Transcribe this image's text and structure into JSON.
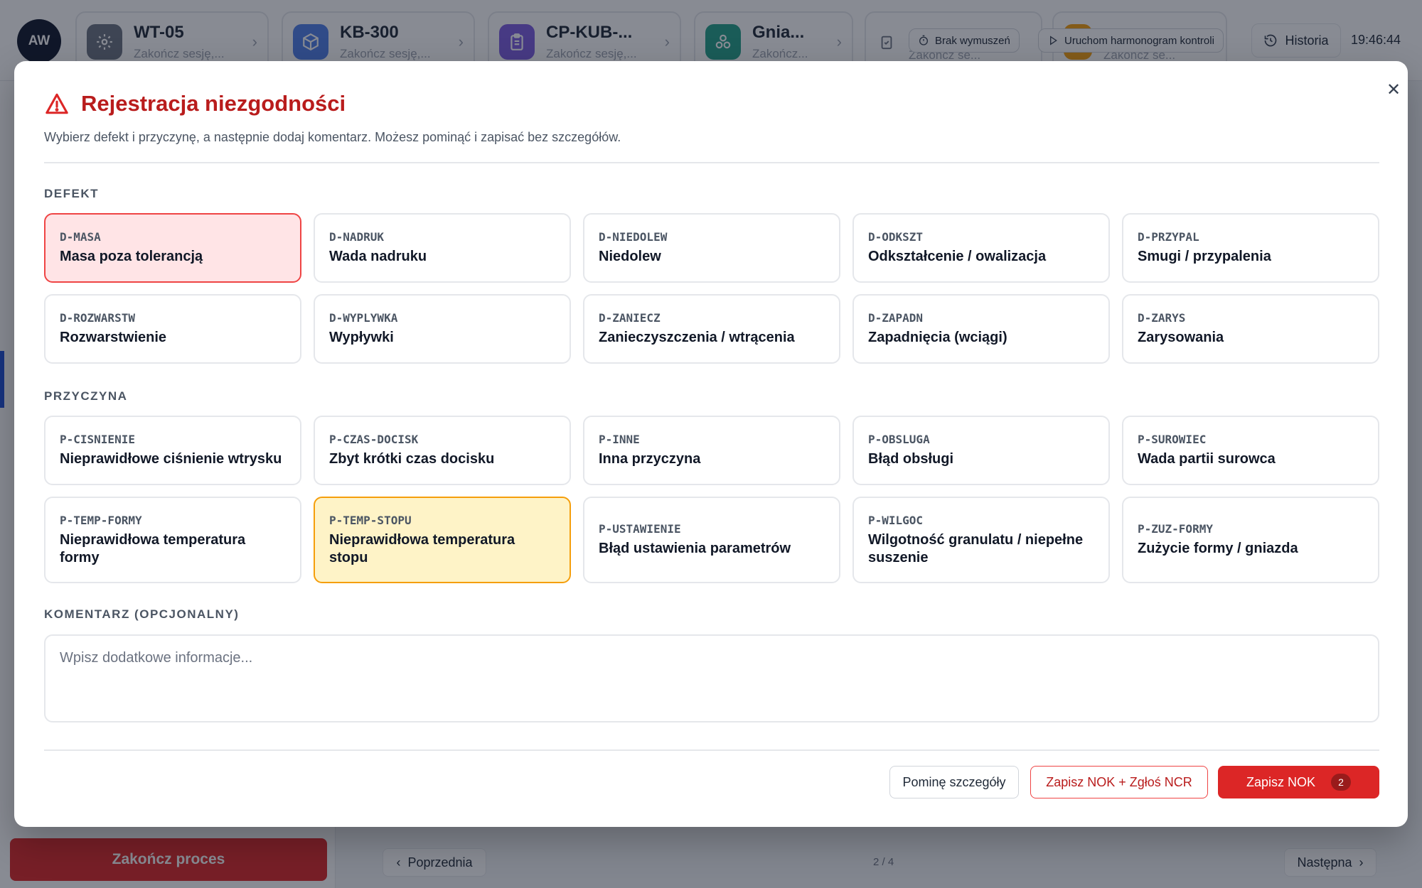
{
  "header": {
    "user_initials": "AW",
    "stations": [
      {
        "name": "WT-05",
        "sub": "Zakończ sesję,..."
      },
      {
        "name": "KB-300",
        "sub": "Zakończ sesję,..."
      },
      {
        "name": "CP-KUB-...",
        "sub": "Zakończ sesję,..."
      },
      {
        "name": "Gnia...",
        "sub": "Zakończ..."
      },
      {
        "name": "",
        "sub": "Zakończ se..."
      },
      {
        "name": "",
        "sub": "Zakończ se..."
      }
    ],
    "no_force_label": "Brak wymuszeń",
    "run_schedule_label": "Uruchom harmonogram kontroli",
    "history_label": "Historia",
    "clock": "19:46:44"
  },
  "background": {
    "finish_process_label": "Zakończ proces",
    "prev_label": "Poprzednia",
    "pager": "2 / 4",
    "next_label": "Następna"
  },
  "modal": {
    "title": "Rejestracja niezgodności",
    "subtitle": "Wybierz defekt i przyczynę, a następnie dodaj komentarz. Możesz pominąć i zapisać bez szczegółów.",
    "defect_section": "DEFEKT",
    "defects": [
      {
        "code": "D-MASA",
        "label": "Masa poza tolerancją",
        "selected": true
      },
      {
        "code": "D-NADRUK",
        "label": "Wada nadruku",
        "selected": false
      },
      {
        "code": "D-NIEDOLEW",
        "label": "Niedolew",
        "selected": false
      },
      {
        "code": "D-ODKSZT",
        "label": "Odkształcenie / owalizacja",
        "selected": false
      },
      {
        "code": "D-PRZYPAL",
        "label": "Smugi / przypalenia",
        "selected": false
      },
      {
        "code": "D-ROZWARSTW",
        "label": "Rozwarstwienie",
        "selected": false
      },
      {
        "code": "D-WYPLYWKA",
        "label": "Wypływki",
        "selected": false
      },
      {
        "code": "D-ZANIECZ",
        "label": "Zanieczyszczenia / wtrącenia",
        "selected": false
      },
      {
        "code": "D-ZAPADN",
        "label": "Zapadnięcia (wciągi)",
        "selected": false
      },
      {
        "code": "D-ZARYS",
        "label": "Zarysowania",
        "selected": false
      }
    ],
    "cause_section": "PRZYCZYNA",
    "causes": [
      {
        "code": "P-CISNIENIE",
        "label": "Nieprawidłowe ciśnienie wtrysku",
        "selected": false
      },
      {
        "code": "P-CZAS-DOCISK",
        "label": "Zbyt krótki czas docisku",
        "selected": false
      },
      {
        "code": "P-INNE",
        "label": "Inna przyczyna",
        "selected": false
      },
      {
        "code": "P-OBSLUGA",
        "label": "Błąd obsługi",
        "selected": false
      },
      {
        "code": "P-SUROWIEC",
        "label": "Wada partii surowca",
        "selected": false
      },
      {
        "code": "P-TEMP-FORMY",
        "label": "Nieprawidłowa temperatura formy",
        "selected": false
      },
      {
        "code": "P-TEMP-STOPU",
        "label": "Nieprawidłowa temperatura stopu",
        "selected": true
      },
      {
        "code": "P-USTAWIENIE",
        "label": "Błąd ustawienia parametrów",
        "selected": false
      },
      {
        "code": "P-WILGOC",
        "label": "Wilgotność granulatu / niepełne suszenie",
        "selected": false
      },
      {
        "code": "P-ZUZ-FORMY",
        "label": "Zużycie formy / gniazda",
        "selected": false
      }
    ],
    "comment_section": "KOMENTARZ (OPCJONALNY)",
    "comment_placeholder": "Wpisz dodatkowe informacje...",
    "comment_value": "",
    "skip_label": "Pominę szczegóły",
    "save_ncr_label": "Zapisz NOK + Zgłoś NCR",
    "save_nok_label": "Zapisz NOK",
    "save_nok_shortcut": "2"
  },
  "colors": {
    "accent_red": "#dc2626",
    "selected_defect_bg": "#ffe4e6",
    "selected_cause_bg": "#fef3c7"
  }
}
